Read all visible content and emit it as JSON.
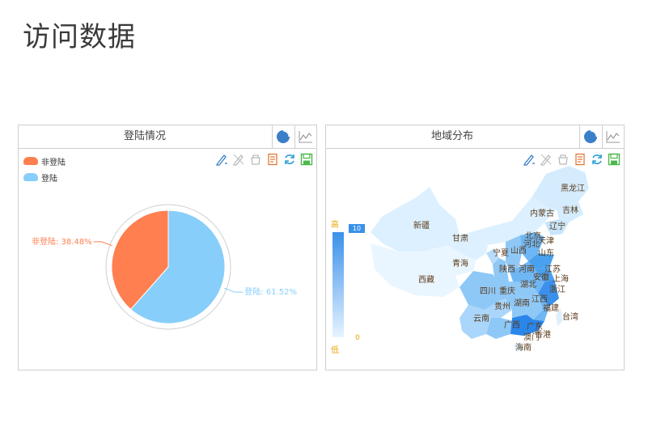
{
  "page": {
    "title": "访问数据"
  },
  "login_panel": {
    "title": "登陆情况",
    "legend": [
      {
        "label": "非登陆",
        "color": "#ff7f50"
      },
      {
        "label": "登陆",
        "color": "#87cefa"
      }
    ],
    "labels": {
      "non_login": "非登陆: 38.48%",
      "login": "登陆: 61.52%"
    },
    "tools": [
      "mark-icon",
      "unmark-icon",
      "clear-icon",
      "data-view-icon",
      "refresh-icon",
      "save-image-icon"
    ],
    "views": [
      "pie-icon",
      "line-icon"
    ]
  },
  "region_panel": {
    "title": "地域分布",
    "visual_map": {
      "high": "高",
      "low": "低",
      "max": "10",
      "min": "0"
    },
    "tools": [
      "mark-icon",
      "unmark-icon",
      "clear-icon",
      "data-view-icon",
      "refresh-icon",
      "save-image-icon"
    ],
    "views": [
      "pie-icon",
      "line-icon"
    ],
    "provinces": [
      "黑龙江",
      "吉林",
      "辽宁",
      "内蒙古",
      "北京",
      "天津",
      "河北",
      "山西",
      "山东",
      "新疆",
      "甘肃",
      "宁夏",
      "青海",
      "陕西",
      "河南",
      "江苏",
      "安徽",
      "上海",
      "西藏",
      "四川",
      "重庆",
      "湖北",
      "浙江",
      "贵州",
      "湖南",
      "江西",
      "福建",
      "台湾",
      "云南",
      "广西",
      "广东",
      "香港",
      "澳门",
      "海南"
    ]
  },
  "chart_data": [
    {
      "type": "pie",
      "title": "登陆情况",
      "categories": [
        "非登陆",
        "登陆"
      ],
      "values": [
        38.48,
        61.52
      ],
      "unit": "%",
      "colors": [
        "#ff7f50",
        "#87cefa"
      ],
      "legend_position": "top-left"
    }
  ]
}
